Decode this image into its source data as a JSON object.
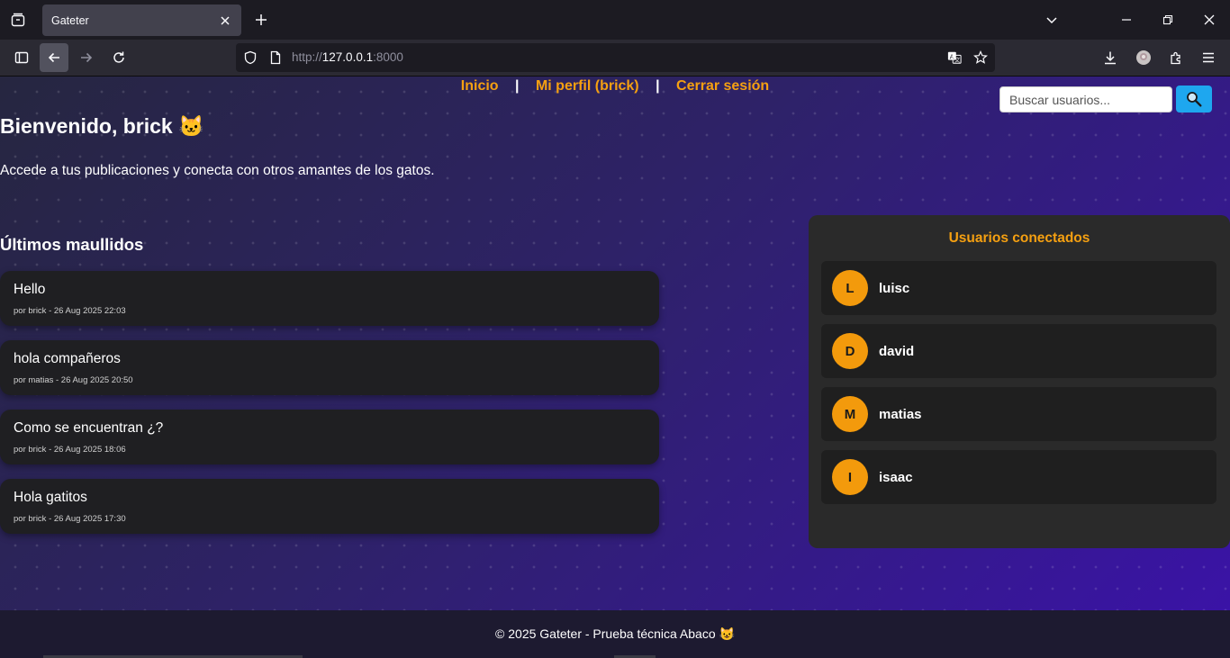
{
  "browser": {
    "tab_title": "Gateter",
    "url_prefix": "http://",
    "url_host": "127.0.0.1",
    "url_port": ":8000"
  },
  "nav": {
    "home": "Inicio",
    "profile": "Mi perfil (brick)",
    "logout": "Cerrar sesión",
    "separator": "|"
  },
  "search": {
    "placeholder": "Buscar usuarios..."
  },
  "welcome": {
    "title": "Bienvenido, brick 🐱",
    "subtitle": "Accede a tus publicaciones y conecta con otros amantes de los gatos."
  },
  "posts_section": {
    "title": "Últimos maullidos",
    "posts": [
      {
        "text": "Hello",
        "meta": "por brick - 26 Aug 2025 22:03"
      },
      {
        "text": "hola compañeros",
        "meta": "por matias - 26 Aug 2025 20:50"
      },
      {
        "text": "Como se encuentran ¿?",
        "meta": "por brick - 26 Aug 2025 18:06"
      },
      {
        "text": "Hola gatitos",
        "meta": "por brick - 26 Aug 2025 17:30"
      }
    ]
  },
  "sidebar": {
    "title": "Usuarios conectados",
    "users": [
      {
        "initial": "L",
        "name": "luisc"
      },
      {
        "initial": "D",
        "name": "david"
      },
      {
        "initial": "M",
        "name": "matias"
      },
      {
        "initial": "I",
        "name": "isaac"
      }
    ]
  },
  "footer": {
    "text": "© 2025 Gateter - Prueba técnica Abaco 😺"
  },
  "colors": {
    "accent": "#f5a011",
    "search_button": "#1ea7ef",
    "card": "#1f1f22",
    "sidebar": "#2a2a2a"
  },
  "icons": [
    "tab-list-icon",
    "close-icon",
    "plus-icon",
    "chevron-down-icon",
    "minimize-icon",
    "restore-icon",
    "window-close-icon",
    "sidebar-icon",
    "back-icon",
    "forward-icon",
    "reload-icon",
    "shield-icon",
    "page-icon",
    "translate-icon",
    "star-icon",
    "download-icon",
    "account-icon",
    "extensions-icon",
    "menu-icon",
    "search-icon"
  ]
}
